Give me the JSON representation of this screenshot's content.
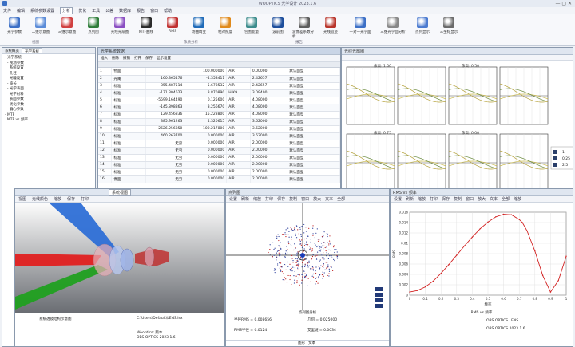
{
  "app": {
    "title": "WOOPTICS 光学设计 2023.1.6",
    "menus": [
      "文件",
      "编辑",
      "系统参数设置",
      "分析",
      "优化",
      "工具",
      "公差",
      "数据库",
      "报告",
      "窗口",
      "帮助"
    ]
  },
  "ribbon": {
    "buttons": [
      "光学参数",
      "二维示意图",
      "三维示意图",
      "点列图",
      "光线光扇图",
      "MTF曲线",
      "RMS",
      "场曲畸变",
      "相对照度",
      "包围能量",
      "波前图",
      "波像差系数分析",
      "光线追迹",
      "一对一光学面",
      "三维光学面分析",
      "点列显示",
      "三坐标显示"
    ],
    "groups": [
      "视图",
      "像质分析",
      "报告"
    ]
  },
  "left_panel": {
    "tabs": [
      "系统概览",
      "光学系统"
    ],
    "tree": [
      "- 光学系统",
      "  - 视场参数",
      "    系统设置",
      "  - 孔径",
      "    光瞳设置",
      "  - 波长",
      "  - 光学表面",
      "    光学材料",
      "    表面参数",
      "  - 优化参数",
      "    偏心参数",
      "- MTF",
      "  MTF vs 频率"
    ]
  },
  "lens_table": {
    "tab": "光学系统数据",
    "toolbar": [
      "插入",
      "删除",
      "撤销",
      "打开",
      "保存",
      "显示设置"
    ],
    "rows": [
      [
        "1",
        "物面",
        "",
        "100.000000",
        "AIR",
        "0.00000",
        "默认面型"
      ],
      [
        "2",
        "光阑",
        "160.365476",
        "-4.358411",
        "AIR",
        "2.42657",
        "默认面型"
      ],
      [
        "3",
        "标准",
        "355.487514",
        "5.678532",
        "AIR",
        "2.42657",
        "默认面型"
      ],
      [
        "4",
        "标准",
        "-171.304623",
        "3.870890",
        "H-K9",
        "3.09400",
        "默认面型"
      ],
      [
        "5",
        "标准",
        "-5599.164490",
        "0.125600",
        "AIR",
        "4.08000",
        "默认面型"
      ],
      [
        "6",
        "标准",
        "-145.898863",
        "3.256670",
        "AIR",
        "4.08000",
        "默认面型"
      ],
      [
        "7",
        "标准",
        "129.456836",
        "15.223800",
        "AIR",
        "4.08000",
        "默认面型"
      ],
      [
        "8",
        "标准",
        "385.961263",
        "4.320615",
        "AIR",
        "3.62000",
        "默认面型"
      ],
      [
        "9",
        "标准",
        "2626.256850",
        "100.217800",
        "AIR",
        "3.62000",
        "默认面型"
      ],
      [
        "10",
        "标准",
        "460.263700",
        "0.000000",
        "AIR",
        "3.62000",
        "默认面型"
      ],
      [
        "11",
        "标准",
        "无穷",
        "0.000000",
        "AIR",
        "2.00000",
        "默认面型"
      ],
      [
        "12",
        "标准",
        "无穷",
        "0.000000",
        "AIR",
        "2.00000",
        "默认面型"
      ],
      [
        "13",
        "标准",
        "无穷",
        "0.000000",
        "AIR",
        "2.00000",
        "默认面型"
      ],
      [
        "14",
        "标准",
        "无穷",
        "0.000000",
        "AIR",
        "2.00000",
        "默认面型"
      ],
      [
        "15",
        "标准",
        "无穷",
        "0.000000",
        "AIR",
        "2.00000",
        "默认面型"
      ],
      [
        "16",
        "像面",
        "无穷",
        "0.000000",
        "AIR",
        "2.00000",
        "默认面型"
      ]
    ]
  },
  "fan_window": {
    "title": "光线光扇图",
    "labels": [
      "像高: 1.00",
      "像高: 0.50",
      "像高: 0.75",
      "像高: 0.00"
    ],
    "legend": [
      "1",
      "0.25",
      "2.5"
    ]
  },
  "layout_window": {
    "title": "系统视图",
    "menu": [
      "视图",
      "光线颜色",
      "缩放",
      "保存",
      "打印"
    ],
    "caption": "系统视图",
    "status_left": "系统透镜结构示意图",
    "status_right": "C:\\Users\\Default\\LENS.lsx",
    "info1": "Wooptics: 版本",
    "info2": "OBS OPTICS 2023.1.6"
  },
  "spot_window": {
    "title": "点列图",
    "menu": [
      "设置",
      "刷新",
      "缩放",
      "打印",
      "保存",
      "复制",
      "窗口",
      "放大",
      "文本",
      "全部"
    ],
    "caption": "点列图分析",
    "stats": [
      "半径RMS = 0.008656",
      "几何 = 0.025000",
      "RMS半径 = 0.0124",
      "艾里斑 = 0.0034"
    ],
    "footer_tabs": [
      "图形",
      "文本"
    ]
  },
  "rms_window": {
    "title": "RMS vs 频率",
    "menu": [
      "设置",
      "刷新",
      "缩放",
      "打印",
      "保存",
      "复制",
      "窗口",
      "放大",
      "文本",
      "全部",
      "缩放"
    ],
    "caption": "RMS vs 频率",
    "info1": "OBS OPTICS LENS",
    "info2": "OBS OPTICS 2023.1.6"
  },
  "chart_data": {
    "type": "line",
    "title": "RMS vs 频率",
    "xlabel": "频率",
    "ylabel": "RMS",
    "xlim": [
      0,
      1
    ],
    "ylim": [
      0,
      0.016
    ],
    "x_ticks": [
      "0",
      "0.1",
      "0.2",
      "0.3",
      "0.4",
      "0.5",
      "0.6",
      "0.7",
      "0.8",
      "0.9",
      "1"
    ],
    "y_ticks": [
      "0",
      "0.002",
      "0.004",
      "0.006",
      "0.008",
      "0.01",
      "0.012",
      "0.014",
      "0.016"
    ],
    "series": [
      {
        "color": "#d22222",
        "x": [
          0,
          0.05,
          0.1,
          0.15,
          0.2,
          0.25,
          0.3,
          0.35,
          0.4,
          0.45,
          0.5,
          0.55,
          0.6,
          0.65,
          0.7,
          0.72,
          0.75,
          0.8,
          0.85,
          0.9,
          0.95,
          1.0
        ],
        "y": [
          0.0006,
          0.0009,
          0.0016,
          0.0027,
          0.0042,
          0.0059,
          0.0077,
          0.0095,
          0.0112,
          0.0128,
          0.0141,
          0.0151,
          0.0156,
          0.0155,
          0.0146,
          0.014,
          0.0124,
          0.0085,
          0.0038,
          0.0006,
          0.0028,
          0.0075
        ]
      }
    ]
  }
}
